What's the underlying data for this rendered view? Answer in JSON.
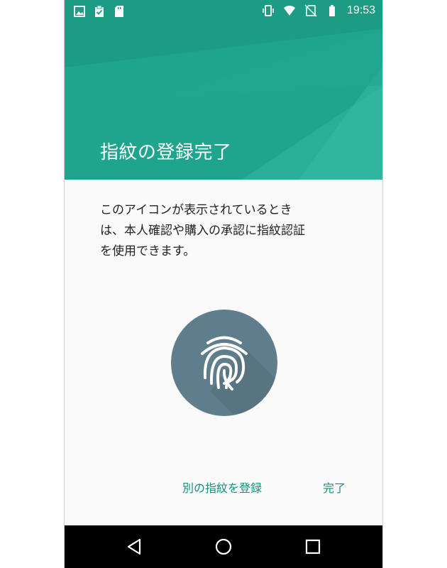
{
  "status_bar": {
    "time": "19:53",
    "left_icons": [
      "image-icon",
      "clipboard-check-icon",
      "sd-card-icon"
    ],
    "right_icons": [
      "vibrate-icon",
      "wifi-icon",
      "no-sim-icon",
      "battery-icon"
    ]
  },
  "header": {
    "title": "指紋の登録完了",
    "color": "#1fa58e"
  },
  "body": {
    "description_lines": [
      "このアイコンが表示されているとき",
      "は、本人確認や購入の承認に指紋認証",
      "を使用できます。"
    ]
  },
  "fingerprint": {
    "icon": "fingerprint-icon",
    "color": "#607d8b"
  },
  "actions": {
    "add_another": "別の指紋を登録",
    "done": "完了",
    "accent": "#1a8e7d"
  },
  "navigation": {
    "buttons": [
      "back-icon",
      "home-icon",
      "recents-icon"
    ]
  }
}
